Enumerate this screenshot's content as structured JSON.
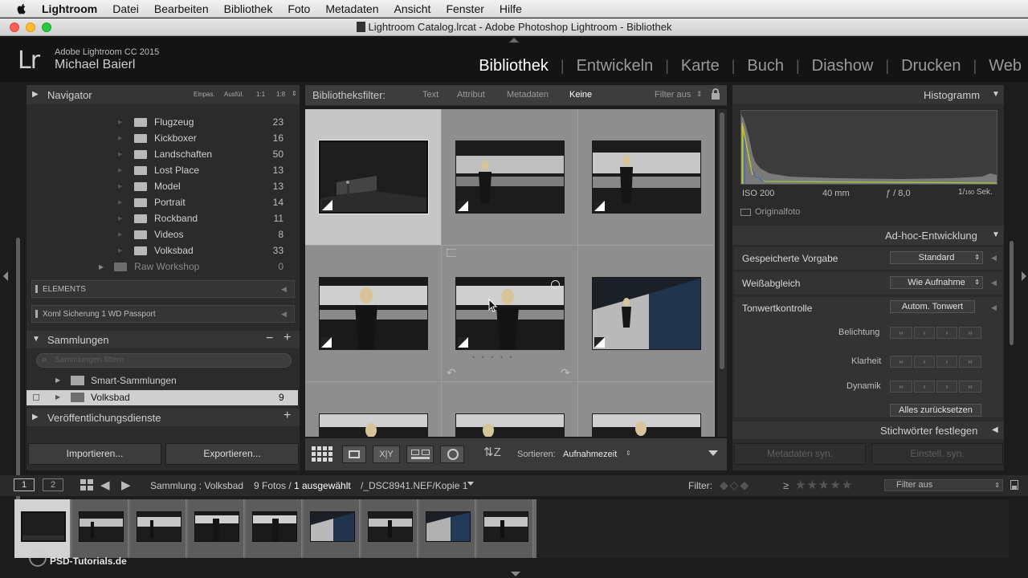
{
  "menubar": {
    "items": [
      "Lightroom",
      "Datei",
      "Bearbeiten",
      "Bibliothek",
      "Foto",
      "Metadaten",
      "Ansicht",
      "Fenster",
      "Hilfe"
    ]
  },
  "window": {
    "title": "Lightroom Catalog.lrcat - Adobe Photoshop Lightroom - Bibliothek"
  },
  "identity": {
    "logo": "Lr",
    "version": "Adobe Lightroom CC 2015",
    "user": "Michael Baierl"
  },
  "modules": [
    "Bibliothek",
    "Entwickeln",
    "Karte",
    "Buch",
    "Diashow",
    "Drucken",
    "Web"
  ],
  "navigator": {
    "label": "Navigator",
    "zoom": [
      "Einpas.",
      "Ausfül.",
      "1:1",
      "1:8"
    ]
  },
  "folders": [
    {
      "name": "Flugzeug",
      "count": "23"
    },
    {
      "name": "Kickboxer",
      "count": "16"
    },
    {
      "name": "Landschaften",
      "count": "50"
    },
    {
      "name": "Lost Place",
      "count": "13"
    },
    {
      "name": "Model",
      "count": "13"
    },
    {
      "name": "Portrait",
      "count": "14"
    },
    {
      "name": "Rockband",
      "count": "11"
    },
    {
      "name": "Videos",
      "count": "8"
    },
    {
      "name": "Volksbad",
      "count": "33"
    }
  ],
  "raw_workshop": {
    "name": "Raw Workshop",
    "count": "0"
  },
  "volumes": [
    "ELEMENTS",
    "Xoml Sicherung 1 WD Passport"
  ],
  "collections": {
    "label": "Sammlungen",
    "search_placeholder": "Sammlungen filtern",
    "items": [
      {
        "name": "Smart-Sammlungen",
        "count": ""
      },
      {
        "name": "Volksbad",
        "count": "9"
      }
    ]
  },
  "publish": {
    "label": "Veröffentlichungsdienste"
  },
  "left_buttons": {
    "import": "Importieren...",
    "export": "Exportieren..."
  },
  "filterbar": {
    "label": "Bibliotheksfilter:",
    "options": [
      "Text",
      "Attribut",
      "Metadaten",
      "Keine"
    ],
    "active": "Keine",
    "preset": "Filter aus"
  },
  "toolbar": {
    "sort_label": "Sortieren:",
    "sort_value": "Aufnahmezeit"
  },
  "histogram": {
    "label": "Histogramm",
    "iso": "ISO 200",
    "focal": "40 mm",
    "aperture": "ƒ / 8,0",
    "shutter_num": "1",
    "shutter_den": "160",
    "shutter_unit": "Sek.",
    "original_label": "Originalfoto"
  },
  "quick_develop": {
    "label": "Ad-hoc-Entwicklung",
    "saved_preset_label": "Gespeicherte Vorgabe",
    "saved_preset_value": "Standard",
    "wb_label": "Weißabgleich",
    "wb_value": "Wie Aufnahme",
    "tone_label": "Tonwertkontrolle",
    "auto_tone": "Autom. Tonwert",
    "exposure": "Belichtung",
    "clarity": "Klarheit",
    "vibrance": "Dynamik",
    "reset": "Alles zurücksetzen"
  },
  "keywording": {
    "label": "Stichwörter festlegen"
  },
  "right_buttons": {
    "sync_meta": "Metadaten syn.",
    "sync_settings": "Einstell. syn."
  },
  "status": {
    "page1": "1",
    "page2": "2",
    "source": "Sammlung : Volksbad",
    "photos": "9 Fotos /",
    "selected": "1 ausgewählt",
    "file": "/_DSC8941.NEF/Kopie 1",
    "filter_label": "Filter:",
    "rating_op": "≥",
    "filter_value": "Filter aus"
  },
  "watermark": "PSD-Tutorials.de",
  "colors": {
    "accent_active": "#ffffff",
    "panel": "#2b2b2b",
    "grid": "#8c8c8c"
  }
}
